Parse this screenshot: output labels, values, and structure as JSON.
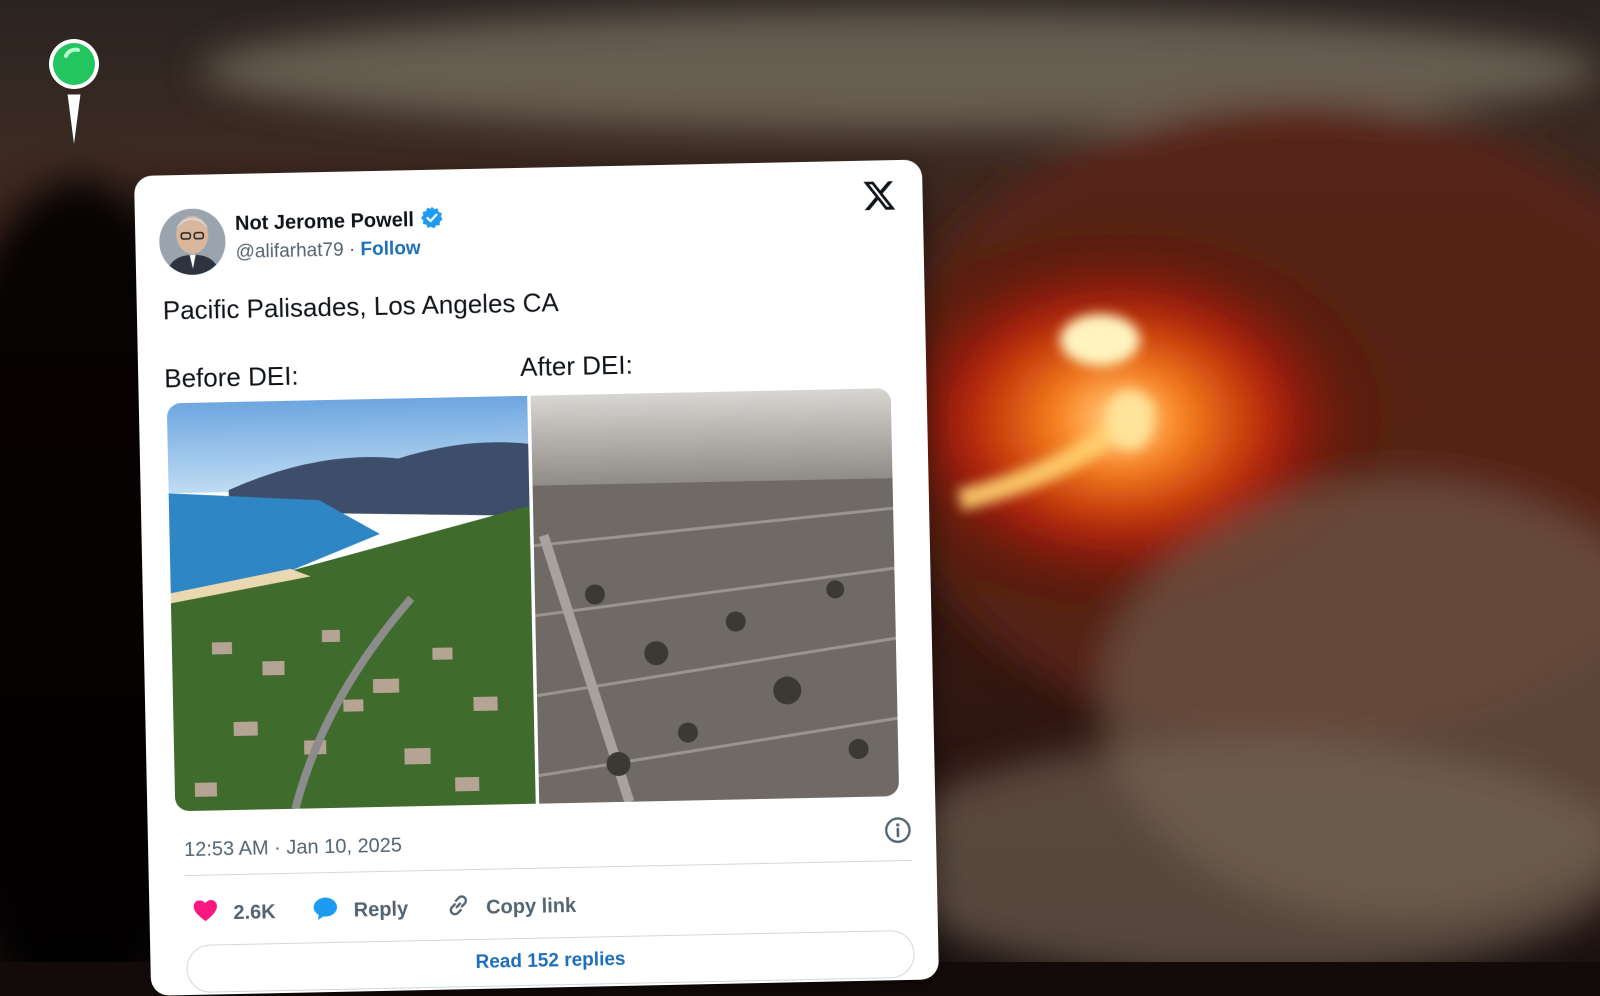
{
  "tweet": {
    "author_name": "Not Jerome Powell",
    "author_handle": "@alifarhat79",
    "separator": "·",
    "follow_label": "Follow",
    "text": "Pacific Palisades, Los Angeles CA",
    "label_before": "Before DEI:",
    "label_after": "After DEI:",
    "timestamp": "12:53 AM · Jan 10, 2025",
    "likes": "2.6K",
    "reply_label": "Reply",
    "copy_link_label": "Copy link",
    "read_replies_label": "Read 152 replies"
  },
  "icons": {
    "pin": "map-pin-icon",
    "verified": "verified-badge-icon",
    "x": "x-logo-icon",
    "info": "info-icon",
    "heart": "heart-icon",
    "reply": "reply-bubble-icon",
    "link": "link-icon"
  },
  "colors": {
    "pin_green": "#22c55e",
    "verified_blue": "#1d9bf0",
    "like_pink": "#f91880",
    "link_blue": "#1d6fb8",
    "text_dark": "#0f1419",
    "text_gray": "#536471",
    "fire_orange": "#ff6a1a"
  }
}
